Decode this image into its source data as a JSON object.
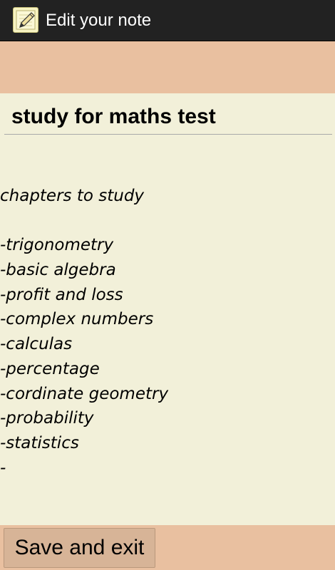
{
  "header": {
    "title": "Edit your note",
    "icon": "note-pencil-icon"
  },
  "note": {
    "title": "study for maths test",
    "body_lines": [
      "chapters to study",
      "",
      "-trigonometry",
      "-basic algebra",
      "-profit and loss",
      "-complex numbers",
      "-calculas",
      "-percentage",
      "-cordinate geometry",
      "-probability",
      "-statistics",
      "-"
    ]
  },
  "footer": {
    "save_label": "Save and exit"
  },
  "colors": {
    "action_bar": "#222222",
    "accent_band": "#e9c0a0",
    "background": "#f2f0d9",
    "button": "#d7b497"
  }
}
